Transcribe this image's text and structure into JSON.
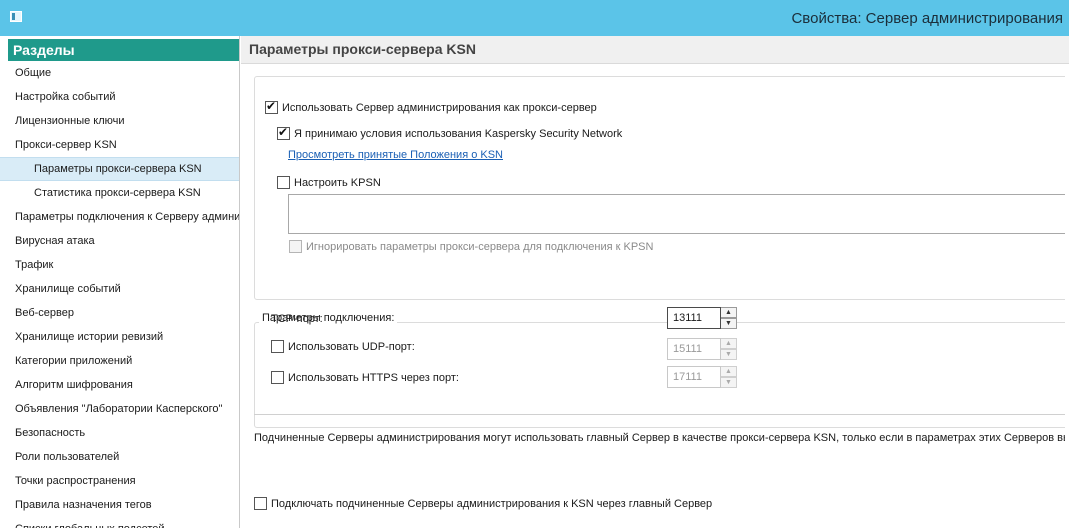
{
  "window": {
    "title": "Свойства: Сервер администрирования"
  },
  "sidebar": {
    "header": "Разделы",
    "items": [
      {
        "label": "Общие"
      },
      {
        "label": "Настройка событий"
      },
      {
        "label": "Лицензионные ключи"
      },
      {
        "label": "Прокси-сервер KSN"
      },
      {
        "label": "Параметры прокси-сервера KSN",
        "sub": true,
        "selected": true
      },
      {
        "label": "Статистика прокси-сервера KSN",
        "sub": true
      },
      {
        "label": "Параметры подключения к Серверу админи"
      },
      {
        "label": "Вирусная атака"
      },
      {
        "label": "Трафик"
      },
      {
        "label": "Хранилище событий"
      },
      {
        "label": "Веб-сервер"
      },
      {
        "label": "Хранилище истории ревизий"
      },
      {
        "label": "Категории приложений"
      },
      {
        "label": "Алгоритм шифрования"
      },
      {
        "label": "Объявления \"Лаборатории Касперского\""
      },
      {
        "label": "Безопасность"
      },
      {
        "label": "Роли пользователей"
      },
      {
        "label": "Точки распространения"
      },
      {
        "label": "Правила назначения тегов"
      },
      {
        "label": "Списки глобальных подсетей"
      }
    ]
  },
  "main": {
    "title": "Параметры прокси-сервера KSN",
    "use_as_proxy": {
      "label": "Использовать Сервер администрирования как прокси-сервер",
      "checked": true
    },
    "accept_ksn": {
      "label": "Я принимаю условия использования Kaspersky Security Network",
      "checked": true
    },
    "view_terms_link": "Просмотреть принятые Положения о KSN",
    "configure_kpsn": {
      "label": "Настроить KPSN",
      "checked": false
    },
    "ignore_proxy": {
      "label": "Игнорировать параметры прокси-сервера для подключения к KPSN",
      "checked": false
    },
    "connection": {
      "legend": "Параметры подключения:",
      "tcp_label": "TCP-порт:",
      "tcp_value": "13111",
      "udp": {
        "label": "Использовать UDP-порт:",
        "checked": false,
        "value": "15111"
      },
      "https": {
        "label": "Использовать HTTPS через порт:",
        "checked": false,
        "value": "17111"
      }
    },
    "info_text": "Подчиненные Серверы администрирования могут использовать главный Сервер в качестве прокси-сервера KSN, только если в параметрах этих Серверов вы",
    "connect_subordinate": {
      "label": "Подключать подчиненные Серверы администрирования к KSN через главный Сервер",
      "checked": false
    }
  }
}
